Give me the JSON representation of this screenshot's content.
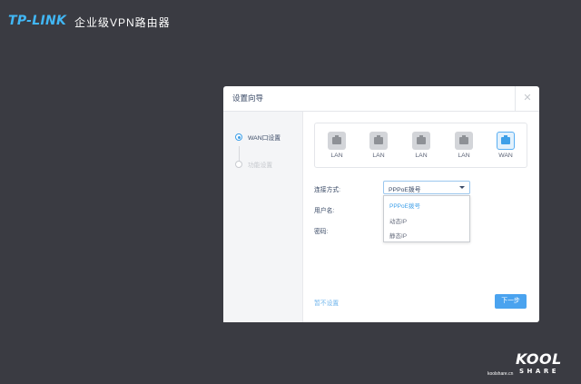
{
  "header": {
    "logo": "TP-LINK",
    "product": "企业级VPN路由器"
  },
  "dialog": {
    "title": "设置向导",
    "close_icon": "close-icon",
    "steps": [
      {
        "label": "WAN口设置",
        "state": "active"
      },
      {
        "label": "功能设置",
        "state": "inactive"
      }
    ],
    "ports": [
      {
        "label": "LAN",
        "icon": "ethernet-port-icon"
      },
      {
        "label": "LAN",
        "icon": "ethernet-port-icon"
      },
      {
        "label": "LAN",
        "icon": "ethernet-port-icon"
      },
      {
        "label": "LAN",
        "icon": "ethernet-port-icon"
      },
      {
        "label": "WAN",
        "icon": "ethernet-port-icon",
        "selected": true
      }
    ],
    "form": {
      "connection_label": "连接方式:",
      "username_label": "用户名:",
      "password_label": "密码:",
      "connection_value": "PPPoE拨号",
      "options": [
        "PPPoE拨号",
        "动态IP",
        "静态IP"
      ]
    },
    "skip_label": "暂不设置",
    "next_label": "下一步"
  },
  "watermark": {
    "url": "koolshare.cn",
    "brand_top": "KOOL",
    "brand_bottom": "SHARE"
  },
  "colors": {
    "background": "#3a3b42",
    "accent": "#3e9fe8",
    "logo": "#41b7f5"
  }
}
